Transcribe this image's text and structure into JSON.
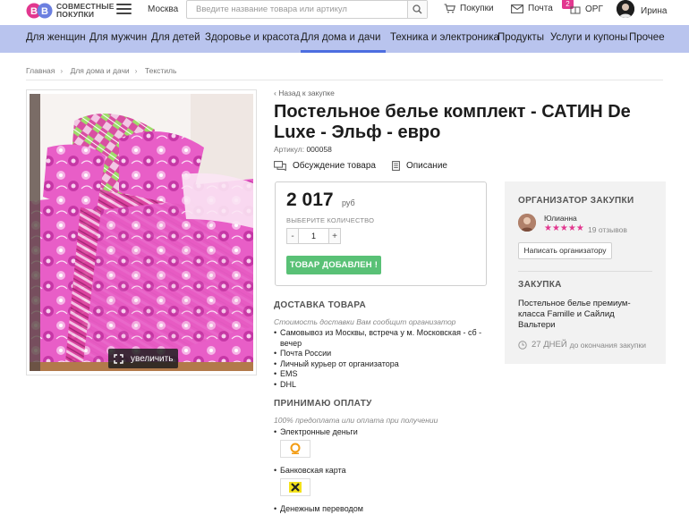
{
  "header": {
    "logo_text_line1": "СОВМЕСТНЫЕ",
    "logo_text_line2": "ПОКУПКИ",
    "city": "Москва",
    "search_placeholder": "Введите название товара или артикул",
    "purchases_label": "Покупки",
    "mail_label": "Почта",
    "org_label": "ОРГ",
    "org_badge": "2",
    "user_name": "Ирина",
    "icons": [
      "logo-mark",
      "menu-icon",
      "search-icon",
      "cart-icon",
      "mail-icon",
      "gift-icon",
      "user-avatar"
    ]
  },
  "categories": {
    "items": [
      "Для женщин",
      "Для мужчин",
      "Для детей",
      "Здоровье и красота",
      "Для дома и дачи",
      "Техника и электроника",
      "Продукты",
      "Услуги и купоны",
      "Прочее"
    ],
    "active": "Для дома и дачи",
    "bg_color": "#b9c4ee",
    "active_color": "#4d6ee0"
  },
  "breadcrumb": [
    "Главная",
    "Для дома и дачи",
    "Текстиль"
  ],
  "product": {
    "back_link": "‹ Назад к закупке",
    "title": "Постельное белье комплект - САТИН De Luxe - Эльф - евро",
    "article_label": "Артикул:",
    "article_value": "000058",
    "tab_discussion": "Обсуждение товара",
    "tab_description": "Описание",
    "zoom_label": "увеличить",
    "price": "2 017",
    "currency": "руб",
    "qty_label": "ВЫБЕРИТЕ КОЛИЧЕСТВО",
    "qty_minus": "-",
    "qty_value": "1",
    "qty_plus": "+",
    "added_button": "ТОВАР ДОБАВЛЕН !",
    "added_color": "#59c176"
  },
  "delivery": {
    "title": "ДОСТАВКА ТОВАРА",
    "note": "Стоимость доставки Вам сообщит организатор",
    "options": [
      "Самовывоз из Москвы, встреча у м. Московская - сб - вечер",
      "Почта России",
      "Личный курьер от организатора",
      "EMS",
      "DHL"
    ]
  },
  "payment": {
    "title": "ПРИНИМАЮ ОПЛАТУ",
    "note": "100% предоплата или оплата при получении",
    "methods": [
      "Электронные деньги",
      "Банковская карта",
      "Денежным переводом"
    ],
    "icons": [
      "qiwi-icon",
      "bank-card-icon"
    ]
  },
  "organizer": {
    "heading": "ОРГАНИЗАТОР ЗАКУПКИ",
    "name": "Юлианна",
    "stars": "★★★★★",
    "reviews": "19 отзывов",
    "write_button": "Написать организатору",
    "star_color": "#e2378f"
  },
  "purchase": {
    "heading": "ЗАКУПКА",
    "name": "Постельное белье премиум-класса Famille и Сайлид Вальтери",
    "days": "27 ДНЕЙ",
    "days_suffix": "до окончания закупки"
  }
}
